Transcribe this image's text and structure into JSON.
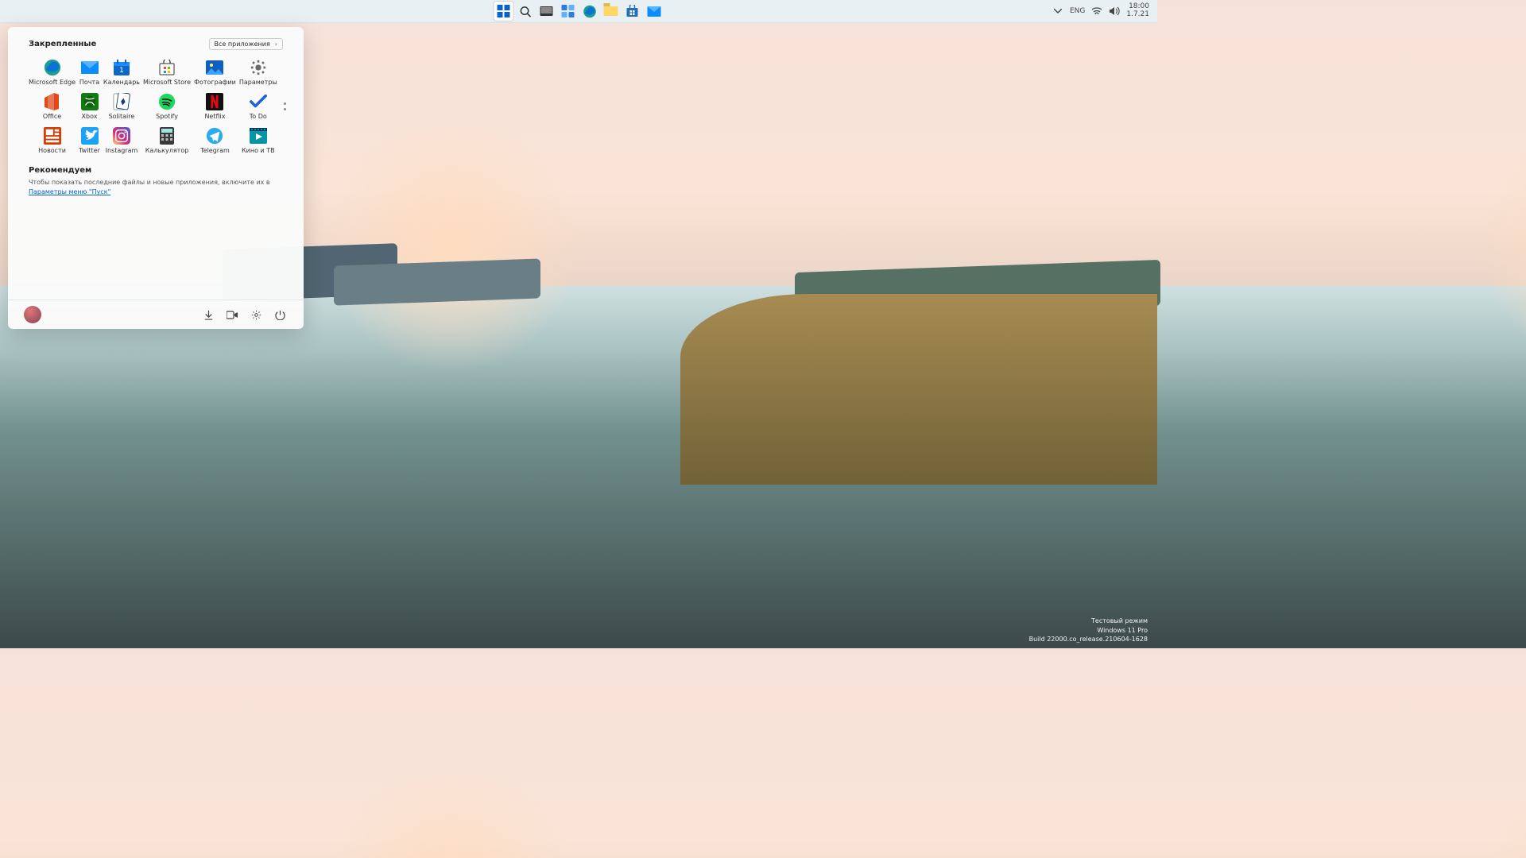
{
  "taskbar": {
    "items": [
      {
        "name": "start-button",
        "icon": "windows"
      },
      {
        "name": "search-button",
        "icon": "search"
      },
      {
        "name": "taskview-button",
        "icon": "taskview"
      },
      {
        "name": "widgets-button",
        "icon": "widgets"
      },
      {
        "name": "edge-button",
        "icon": "edge"
      },
      {
        "name": "explorer-button",
        "icon": "folder"
      },
      {
        "name": "store-button",
        "icon": "store"
      },
      {
        "name": "mail-button",
        "icon": "mail"
      }
    ],
    "language": "ENG",
    "clock_time": "18:00",
    "clock_date": "1.7.21"
  },
  "start_menu": {
    "pinned_title": "Закрепленные",
    "all_apps_label": "Все приложения",
    "apps": [
      {
        "label": "Microsoft Edge",
        "icon": "edge"
      },
      {
        "label": "Почта",
        "icon": "mail"
      },
      {
        "label": "Календарь",
        "icon": "calendar"
      },
      {
        "label": "Microsoft Store",
        "icon": "store"
      },
      {
        "label": "Фотографии",
        "icon": "photos"
      },
      {
        "label": "Параметры",
        "icon": "settings"
      },
      {
        "label": "Office",
        "icon": "office"
      },
      {
        "label": "Xbox",
        "icon": "xbox"
      },
      {
        "label": "Solitaire",
        "icon": "solitaire"
      },
      {
        "label": "Spotify",
        "icon": "spotify"
      },
      {
        "label": "Netflix",
        "icon": "netflix"
      },
      {
        "label": "To Do",
        "icon": "todo"
      },
      {
        "label": "Новости",
        "icon": "news"
      },
      {
        "label": "Twitter",
        "icon": "twitter"
      },
      {
        "label": "Instagram",
        "icon": "instagram"
      },
      {
        "label": "Калькулятор",
        "icon": "calc"
      },
      {
        "label": "Telegram",
        "icon": "telegram"
      },
      {
        "label": "Кино и ТВ",
        "icon": "movies"
      }
    ],
    "recommended_title": "Рекомендуем",
    "recommended_text": "Чтобы показать последние файлы и новые приложения, включите их в ",
    "recommended_link": "Параметры меню \"Пуск\""
  },
  "watermark": {
    "line1": "Тестовый режим",
    "line2": "Windows 11 Pro",
    "line3": "Build 22000.co_release.210604-1628"
  }
}
